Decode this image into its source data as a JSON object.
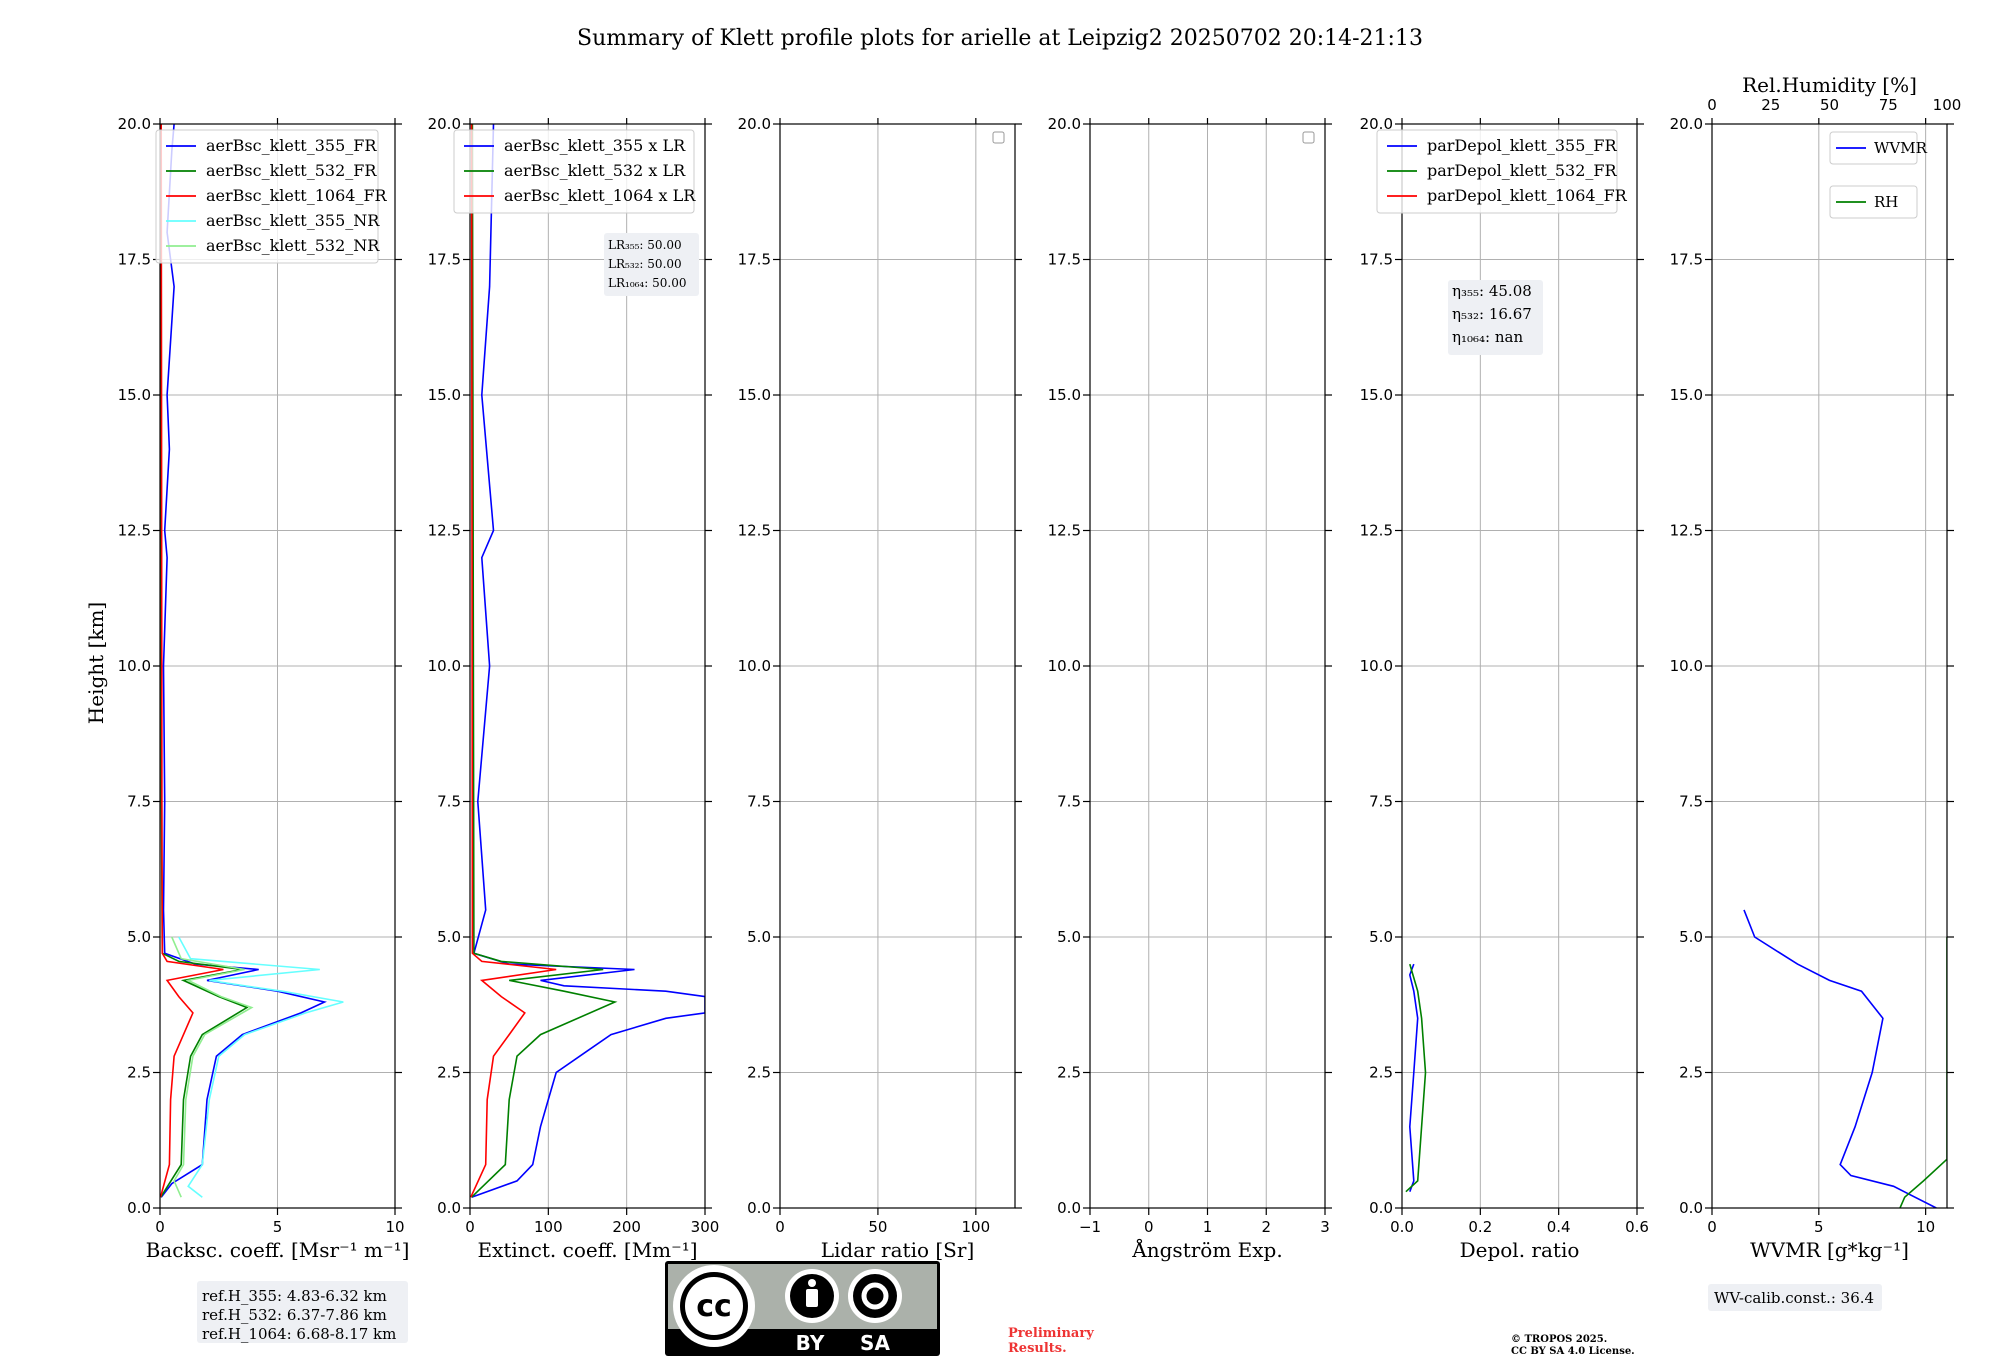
{
  "figure_title": "Summary of Klett profile plots for arielle at Leipzig2 20250702 20:14-21:13",
  "ylabel": "Height [km]",
  "y_ticks": [
    "0.0",
    "2.5",
    "5.0",
    "7.5",
    "10.0",
    "12.5",
    "15.0",
    "17.5",
    "20.0"
  ],
  "ref_heights": [
    "ref.H_355: 4.83-6.32 km",
    "ref.H_532: 6.37-7.86 km",
    "ref.H_1064: 6.68-8.17 km"
  ],
  "license_badge": {
    "by": "BY",
    "sa": "SA",
    "cc": "cc"
  },
  "preliminary": [
    "Preliminary",
    "Results."
  ],
  "copyright": [
    "© TROPOS 2025.",
    "CC BY SA 4.0 License."
  ],
  "wv_calib": "WV-calib.const.: 36.4",
  "colors": {
    "blue": "#0000ff",
    "green": "#008000",
    "red": "#ff0000",
    "cyan": "#66ffff",
    "lightgreen": "#90ee90",
    "grid": "#b0b0b0",
    "textbox": "#eef0f4"
  },
  "chart_data": [
    {
      "type": "line",
      "xlabel": "Backsc. coeff. [Msr⁻¹ m⁻¹]",
      "ylabel": "Height [km]",
      "xlim": [
        0,
        10
      ],
      "ylim": [
        0,
        20
      ],
      "xticks": [
        "0",
        "5",
        "10"
      ],
      "x_tick_values": [
        0,
        5,
        10
      ],
      "legend": "top-left",
      "grid": true,
      "series": [
        {
          "name": "aerBsc_klett_355_FR",
          "color": "#0000ff",
          "x": [
            0.05,
            0.5,
            1.8,
            2.0,
            2.4,
            3.5,
            6.0,
            7.0,
            5.0,
            3.5,
            2.0,
            4.2,
            1.5,
            0.2,
            0.15,
            0.2,
            0.15,
            0.3,
            0.2,
            0.4,
            0.3,
            0.6,
            0.3,
            0.5,
            0.6
          ],
          "y": [
            0.2,
            0.45,
            0.8,
            2.0,
            2.8,
            3.2,
            3.6,
            3.8,
            4.0,
            4.1,
            4.2,
            4.4,
            4.5,
            4.7,
            5.5,
            7.5,
            10.0,
            12.0,
            12.5,
            14.0,
            15.0,
            17.0,
            18.0,
            19.5,
            20.0
          ]
        },
        {
          "name": "aerBsc_klett_532_FR",
          "color": "#008000",
          "x": [
            0.03,
            0.9,
            1.0,
            1.3,
            1.8,
            3.7,
            2.5,
            1.0,
            3.5,
            0.8,
            0.1,
            0.06,
            0.05
          ],
          "y": [
            0.2,
            0.8,
            2.0,
            2.8,
            3.2,
            3.7,
            3.9,
            4.2,
            4.4,
            4.55,
            4.7,
            7.5,
            20.0
          ]
        },
        {
          "name": "aerBsc_klett_1064_FR",
          "color": "#ff0000",
          "x": [
            0.02,
            0.4,
            0.45,
            0.6,
            1.0,
            1.4,
            0.8,
            0.3,
            2.7,
            0.3,
            0.1,
            0.08,
            0.05
          ],
          "y": [
            0.2,
            0.8,
            2.0,
            2.8,
            3.2,
            3.6,
            3.9,
            4.2,
            4.4,
            4.55,
            4.7,
            7.5,
            20.0
          ]
        },
        {
          "name": "aerBsc_klett_355_NR",
          "color": "#66ffff",
          "x": [
            1.8,
            1.2,
            1.8,
            2.1,
            2.5,
            3.6,
            6.2,
            7.8,
            5.2,
            3.6,
            2.1,
            6.8,
            1.3,
            0.8
          ],
          "y": [
            0.2,
            0.4,
            0.8,
            2.0,
            2.8,
            3.2,
            3.6,
            3.8,
            4.0,
            4.1,
            4.2,
            4.4,
            4.6,
            5.0
          ]
        },
        {
          "name": "aerBsc_klett_532_NR",
          "color": "#90ee90",
          "x": [
            0.9,
            0.6,
            1.0,
            1.1,
            1.4,
            1.9,
            3.9,
            2.6,
            1.2,
            3.6,
            0.9,
            0.5
          ],
          "y": [
            0.2,
            0.5,
            0.8,
            2.0,
            2.8,
            3.2,
            3.7,
            3.9,
            4.2,
            4.4,
            4.6,
            5.0
          ]
        }
      ]
    },
    {
      "type": "line",
      "xlabel": "Extinct. coeff. [Mm⁻¹]",
      "xlim": [
        0,
        300
      ],
      "ylim": [
        0,
        20
      ],
      "xticks": [
        "0",
        "100",
        "200",
        "300"
      ],
      "x_tick_values": [
        0,
        100,
        200,
        300
      ],
      "legend": "top-left",
      "grid": true,
      "annotation": [
        "LR₃₅₅: 50.00",
        "LR₅₃₂: 50.00",
        "LR₁₀₆₄: 50.00"
      ],
      "series": [
        {
          "name": "aerBsc_klett_355 x LR",
          "color": "#0000ff",
          "x": [
            2,
            60,
            80,
            90,
            100,
            110,
            150,
            180,
            250,
            300,
            300,
            250,
            120,
            90,
            210,
            50,
            5,
            20,
            10,
            25,
            15,
            30,
            15,
            25,
            30
          ],
          "y": [
            0.2,
            0.5,
            0.8,
            1.5,
            2.0,
            2.5,
            2.9,
            3.2,
            3.5,
            3.6,
            3.9,
            4.0,
            4.1,
            4.2,
            4.4,
            4.5,
            4.7,
            5.5,
            7.5,
            10.0,
            12.0,
            12.5,
            15.0,
            17.0,
            20.0
          ]
        },
        {
          "name": "aerBsc_klett_532 x LR",
          "color": "#008000",
          "x": [
            2,
            45,
            50,
            60,
            90,
            185,
            120,
            50,
            170,
            40,
            5,
            3
          ],
          "y": [
            0.2,
            0.8,
            2.0,
            2.8,
            3.2,
            3.8,
            4.0,
            4.2,
            4.4,
            4.55,
            4.7,
            20.0
          ]
        },
        {
          "name": "aerBsc_klett_1064 x LR",
          "color": "#ff0000",
          "x": [
            1,
            20,
            22,
            30,
            50,
            70,
            40,
            15,
            110,
            15,
            3,
            2
          ],
          "y": [
            0.2,
            0.8,
            2.0,
            2.8,
            3.2,
            3.6,
            3.9,
            4.2,
            4.4,
            4.55,
            4.7,
            20.0
          ]
        }
      ]
    },
    {
      "type": "line",
      "xlabel": "Lidar ratio [Sr]",
      "xlim": [
        0,
        120
      ],
      "ylim": [
        0,
        20
      ],
      "xticks": [
        "0",
        "50",
        "100"
      ],
      "x_tick_values": [
        0,
        50,
        100
      ],
      "grid": true,
      "series": []
    },
    {
      "type": "line",
      "xlabel": "Ångström Exp.",
      "xlim": [
        -1,
        3
      ],
      "ylim": [
        0,
        20
      ],
      "xticks": [
        "−1",
        "0",
        "1",
        "2",
        "3"
      ],
      "x_tick_values": [
        -1,
        0,
        1,
        2,
        3
      ],
      "grid": true,
      "series": []
    },
    {
      "type": "line",
      "xlabel": "Depol. ratio",
      "xlim": [
        0,
        0.6
      ],
      "ylim": [
        0,
        20
      ],
      "xticks": [
        "0.0",
        "0.2",
        "0.4",
        "0.6"
      ],
      "x_tick_values": [
        0,
        0.2,
        0.4,
        0.6
      ],
      "legend": "top-left",
      "grid": true,
      "annotation": [
        "η₃₅₅: 45.08",
        "η₅₃₂: 16.67",
        "η₁₀₆₄: nan"
      ],
      "series": [
        {
          "name": "parDepol_klett_355_FR",
          "color": "#0000ff",
          "x": [
            0.02,
            0.03,
            0.02,
            0.03,
            0.04,
            0.03,
            0.02,
            0.03
          ],
          "y": [
            0.3,
            0.5,
            1.5,
            2.5,
            3.5,
            4.0,
            4.3,
            4.5
          ]
        },
        {
          "name": "parDepol_klett_532_FR",
          "color": "#008000",
          "x": [
            0.01,
            0.04,
            0.05,
            0.06,
            0.05,
            0.04,
            0.02
          ],
          "y": [
            0.3,
            0.5,
            1.5,
            2.5,
            3.5,
            4.0,
            4.5
          ]
        },
        {
          "name": "parDepol_klett_1064_FR",
          "color": "#ff0000",
          "x": [],
          "y": []
        }
      ]
    },
    {
      "type": "line",
      "xlabel": "WVMR [g*kg⁻¹]",
      "top_xlabel": "Rel.Humidity [%]",
      "xlim": [
        0,
        11
      ],
      "ylim": [
        0,
        20
      ],
      "xticks": [
        "0",
        "5",
        "10"
      ],
      "x_tick_values": [
        0,
        5,
        10
      ],
      "top_xticks": [
        "0",
        "25",
        "50",
        "75",
        "100"
      ],
      "top_x_tick_values": [
        0,
        25,
        50,
        75,
        100
      ],
      "legend": "top-right",
      "grid": true,
      "series": [
        {
          "name": "WVMR",
          "color": "#0000ff",
          "x": [
            10.5,
            8.5,
            6.5,
            6.0,
            6.7,
            7.5,
            8.0,
            8.0,
            7.0,
            5.5,
            4.0,
            2.0,
            1.5
          ],
          "y": [
            0.0,
            0.4,
            0.6,
            0.8,
            1.5,
            2.5,
            3.5,
            3.5,
            4.0,
            4.2,
            4.5,
            5.0,
            5.5
          ]
        },
        {
          "name": "RH",
          "color": "#008000",
          "x": [
            80,
            82,
            90,
            100,
            100,
            100
          ],
          "y": [
            0.0,
            0.2,
            0.5,
            0.9,
            4.3,
            5.0
          ]
        }
      ]
    }
  ]
}
